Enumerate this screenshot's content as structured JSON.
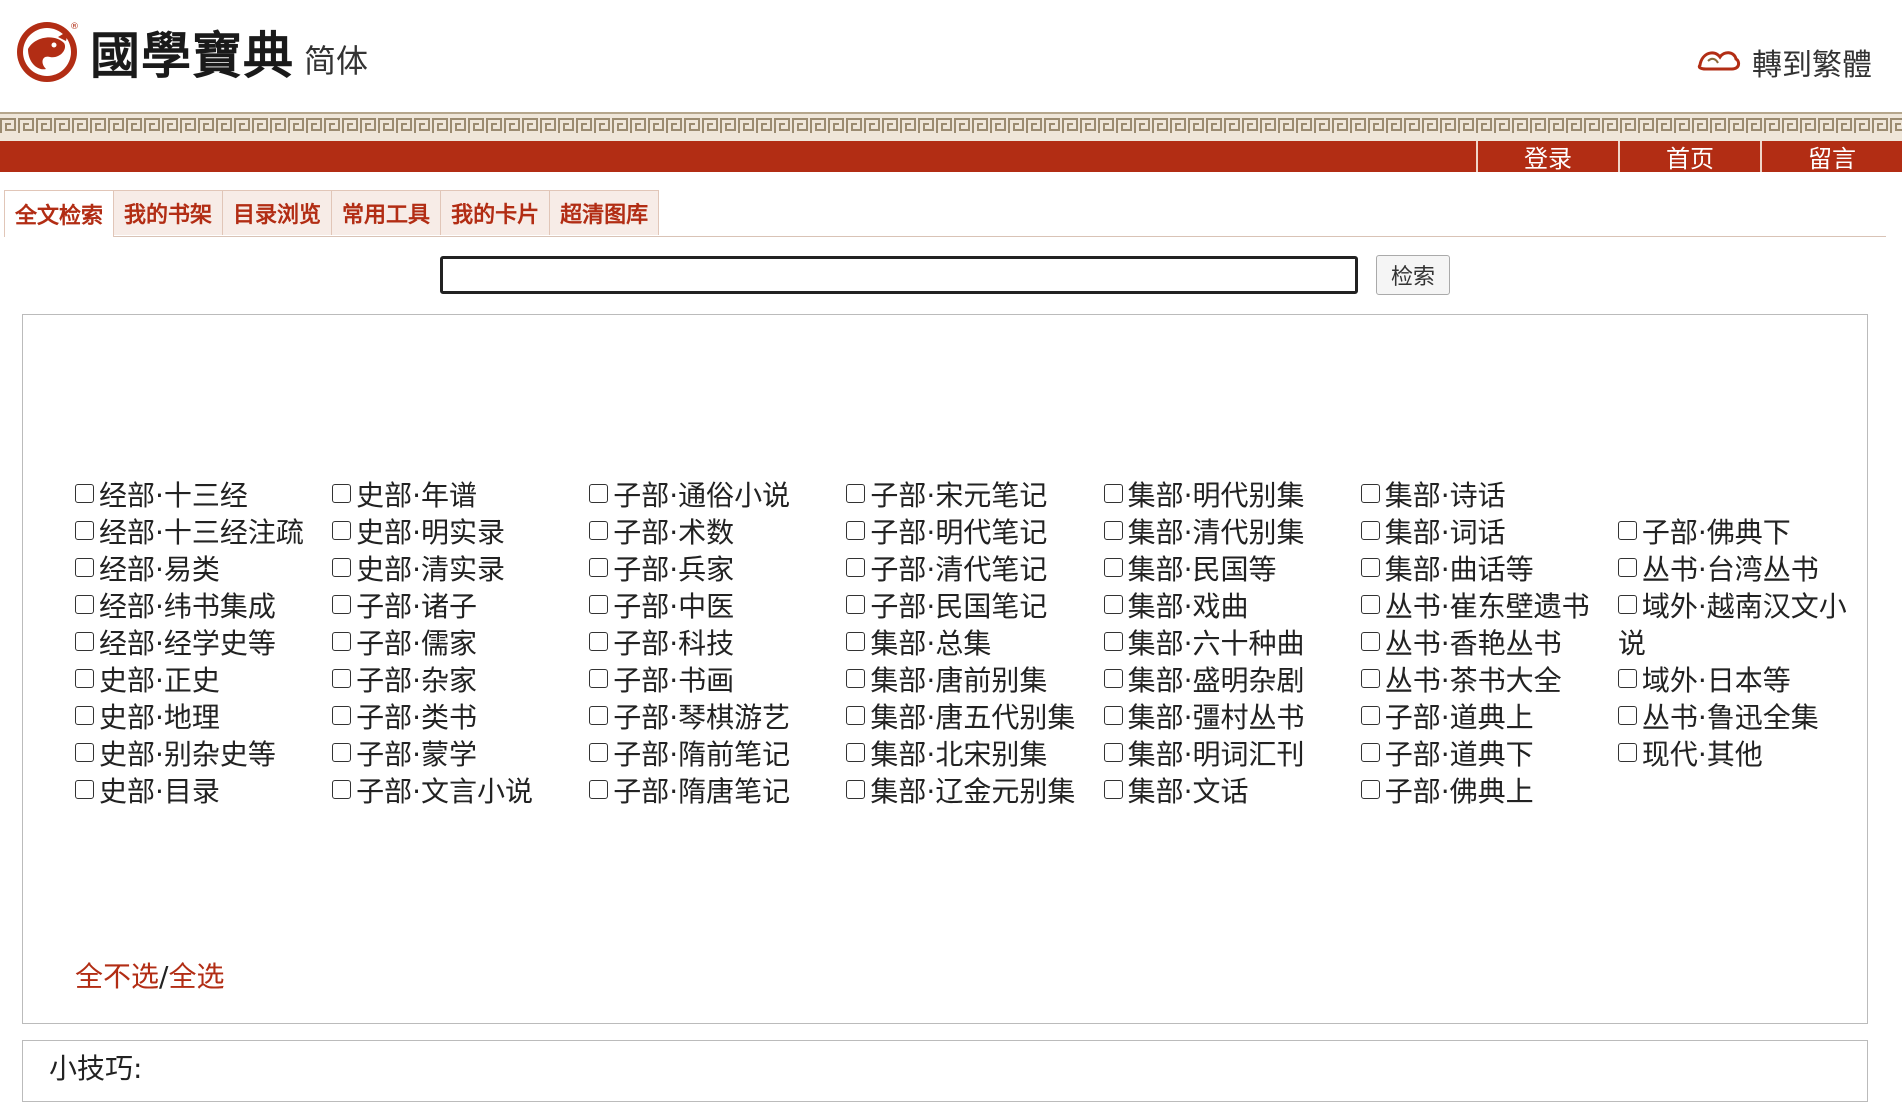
{
  "header": {
    "logo_icon": "dragon-seal-logo-icon",
    "brand": "國學寶典",
    "simplified_label": "简体",
    "switch_traditional": "轉到繁體",
    "switch_icon": "dragon-cloud-icon"
  },
  "nav": {
    "links": [
      "登录",
      "首页",
      "留言"
    ]
  },
  "colors": {
    "accent_red": "#b22d14",
    "band_beige": "#efe6d9"
  },
  "tabs": [
    "全文检索",
    "我的书架",
    "目录浏览",
    "常用工具",
    "我的卡片",
    "超清图库"
  ],
  "search": {
    "value": "",
    "button": "检索"
  },
  "categories": {
    "col1": [
      "经部·十三经",
      "经部·十三经注疏",
      "经部·易类",
      "经部·纬书集成",
      "经部·经学史等",
      "史部·正史",
      "史部·地理",
      "史部·别杂史等",
      "史部·目录"
    ],
    "col2": [
      "史部·年谱",
      "史部·明实录",
      "史部·清实录",
      "子部·诸子",
      "子部·儒家",
      "子部·杂家",
      "子部·类书",
      "子部·蒙学",
      "子部·文言小说"
    ],
    "col3": [
      "子部·通俗小说",
      "子部·术数",
      "子部·兵家",
      "子部·中医",
      "子部·科技",
      "子部·书画",
      "子部·琴棋游艺",
      "子部·隋前笔记",
      "子部·隋唐笔记"
    ],
    "col4": [
      "子部·宋元笔记",
      "子部·明代笔记",
      "子部·清代笔记",
      "子部·民国笔记",
      "集部·总集",
      "集部·唐前别集",
      "集部·唐五代别集",
      "集部·北宋别集",
      "集部·辽金元别集"
    ],
    "col5": [
      "集部·明代别集",
      "集部·清代别集",
      "集部·民国等",
      "集部·戏曲",
      "集部·六十种曲",
      "集部·盛明杂剧",
      "集部·彊村丛书",
      "集部·明词汇刊",
      "集部·文话"
    ],
    "col6": [
      "集部·诗话",
      "集部·词话",
      "集部·曲话等",
      "丛书·崔东壁遗书",
      "丛书·香艳丛书",
      "丛书·茶书大全",
      "子部·道典上",
      "子部·道典下",
      "子部·佛典上"
    ],
    "col7": [
      "子部·佛典下",
      "丛书·台湾丛书",
      "域外·越南汉文小说",
      "域外·日本等",
      "丛书·鲁迅全集",
      "现代·其他"
    ]
  },
  "selectors": {
    "none": "全不选",
    "sep": "/",
    "all": "全选"
  },
  "tips": {
    "label": "小技巧:"
  }
}
